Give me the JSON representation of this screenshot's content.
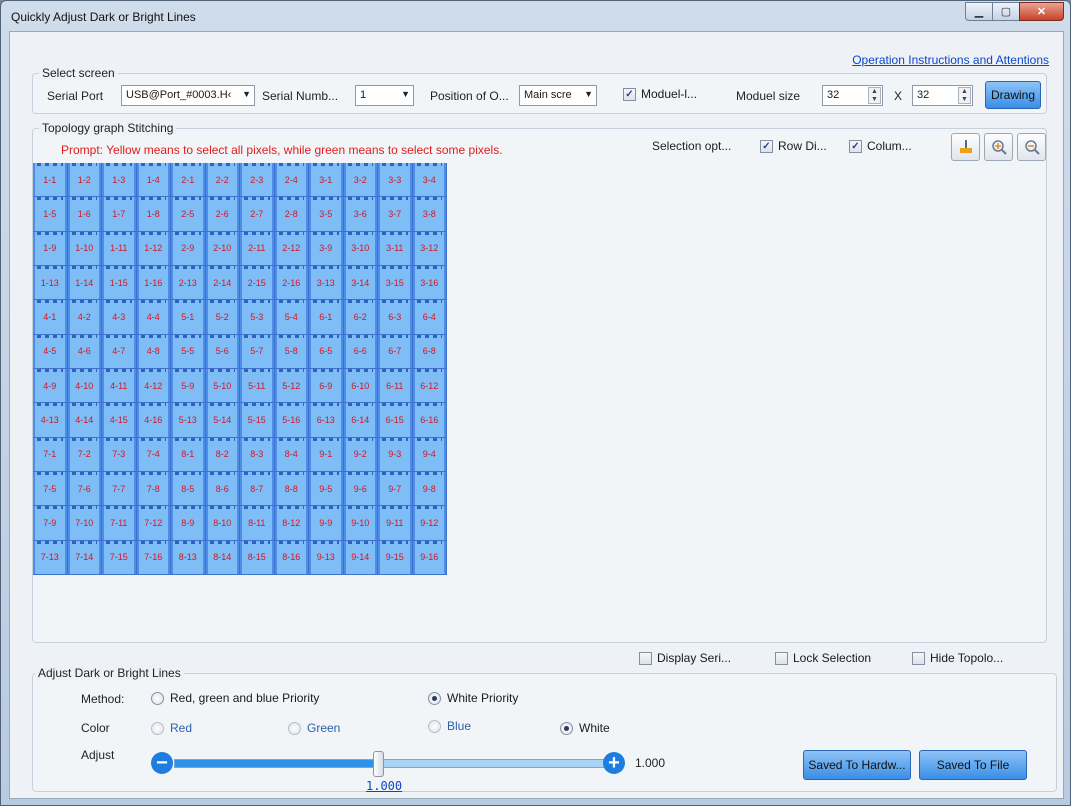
{
  "window": {
    "title": "Quickly Adjust Dark or Bright Lines"
  },
  "instructions_link": "Operation Instructions and Attentions",
  "select_screen": {
    "legend": "Select screen",
    "serial_port_label": "Serial Port",
    "serial_port_value": "USB@Port_#0003.H‹",
    "serial_number_label": "Serial Numb...",
    "serial_number_value": "1",
    "position_label": "Position of O...",
    "position_value": "Main scre",
    "module_checkbox_label": "Moduel-l...",
    "module_size_label": "Moduel size",
    "module_width": "32",
    "times": "X",
    "module_height": "32",
    "drawing_button": "Drawing"
  },
  "topology": {
    "legend": "Topology graph Stitching",
    "prompt": "Prompt: Yellow means to select all pixels, while green means to select some pixels.",
    "selection_label": "Selection opt...",
    "row_label": "Row Di...",
    "column_label": "Colum...",
    "cells": [
      "1-1",
      "1-2",
      "1-3",
      "1-4",
      "2-1",
      "2-2",
      "2-3",
      "2-4",
      "3-1",
      "3-2",
      "3-3",
      "3-4",
      "1-5",
      "1-6",
      "1-7",
      "1-8",
      "2-5",
      "2-6",
      "2-7",
      "2-8",
      "3-5",
      "3-6",
      "3-7",
      "3-8",
      "1-9",
      "1-10",
      "1-11",
      "1-12",
      "2-9",
      "2-10",
      "2-11",
      "2-12",
      "3-9",
      "3-10",
      "3-11",
      "3-12",
      "1-13",
      "1-14",
      "1-15",
      "1-16",
      "2-13",
      "2-14",
      "2-15",
      "2-16",
      "3-13",
      "3-14",
      "3-15",
      "3-16",
      "4-1",
      "4-2",
      "4-3",
      "4-4",
      "5-1",
      "5-2",
      "5-3",
      "5-4",
      "6-1",
      "6-2",
      "6-3",
      "6-4",
      "4-5",
      "4-6",
      "4-7",
      "4-8",
      "5-5",
      "5-6",
      "5-7",
      "5-8",
      "6-5",
      "6-6",
      "6-7",
      "6-8",
      "4-9",
      "4-10",
      "4-11",
      "4-12",
      "5-9",
      "5-10",
      "5-11",
      "5-12",
      "6-9",
      "6-10",
      "6-11",
      "6-12",
      "4-13",
      "4-14",
      "4-15",
      "4-16",
      "5-13",
      "5-14",
      "5-15",
      "5-16",
      "6-13",
      "6-14",
      "6-15",
      "6-16",
      "7-1",
      "7-2",
      "7-3",
      "7-4",
      "8-1",
      "8-2",
      "8-3",
      "8-4",
      "9-1",
      "9-2",
      "9-3",
      "9-4",
      "7-5",
      "7-6",
      "7-7",
      "7-8",
      "8-5",
      "8-6",
      "8-7",
      "8-8",
      "9-5",
      "9-6",
      "9-7",
      "9-8",
      "7-9",
      "7-10",
      "7-11",
      "7-12",
      "8-9",
      "8-10",
      "8-11",
      "8-12",
      "9-9",
      "9-10",
      "9-11",
      "9-12",
      "7-13",
      "7-14",
      "7-15",
      "7-16",
      "8-13",
      "8-14",
      "8-15",
      "8-16",
      "9-13",
      "9-14",
      "9-15",
      "9-16"
    ]
  },
  "options": {
    "display_serial": "Display Seri...",
    "lock_selection": "Lock Selection",
    "hide_topology": "Hide Topolo..."
  },
  "adjust": {
    "legend": "Adjust Dark or Bright Lines",
    "method_label": "Method:",
    "method_rgb": "Red, green and blue Priority",
    "method_white": "White Priority",
    "color_label": "Color",
    "color_red": "Red",
    "color_green": "Green",
    "color_blue": "Blue",
    "color_white": "White",
    "adjust_label": "Adjust",
    "slider_fraction": 0.47,
    "slider_value": "1.000",
    "max_value": "1.000",
    "save_hardware": "Saved To Hardw...",
    "save_file": "Saved To File"
  }
}
